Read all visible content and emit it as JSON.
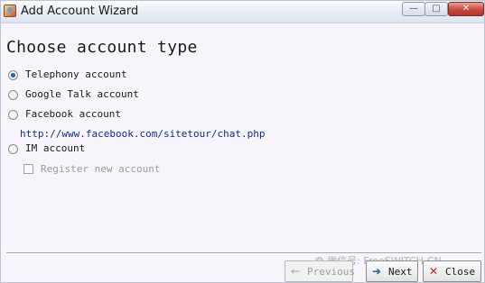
{
  "window": {
    "title": "Add Account Wizard",
    "controls": {
      "minimize": "—",
      "maximize": "□",
      "close": "✕"
    }
  },
  "page": {
    "heading": "Choose account type",
    "options": [
      {
        "label": "Telephony account",
        "checked": true
      },
      {
        "label": "Google Talk account",
        "checked": false
      },
      {
        "label": "Facebook account",
        "checked": false
      },
      {
        "label": "IM account",
        "checked": false
      }
    ],
    "facebook_link": "http://www.facebook.com/sitetour/chat.php",
    "register_label": "Register new account",
    "register_checked": false
  },
  "watermark": {
    "icon": "wechat-icon",
    "text": "微信号: FreeSWITCH-CN"
  },
  "buttons": {
    "previous": {
      "label": "Previous",
      "icon": "arrow-left-icon",
      "enabled": false
    },
    "next": {
      "label": "Next",
      "icon": "arrow-right-icon",
      "enabled": true
    },
    "close": {
      "label": "Close",
      "icon": "close-x-icon",
      "enabled": true
    }
  },
  "colors": {
    "accent": "#1d5fb1",
    "link": "#0b2f8f",
    "close_red": "#c7473a"
  }
}
